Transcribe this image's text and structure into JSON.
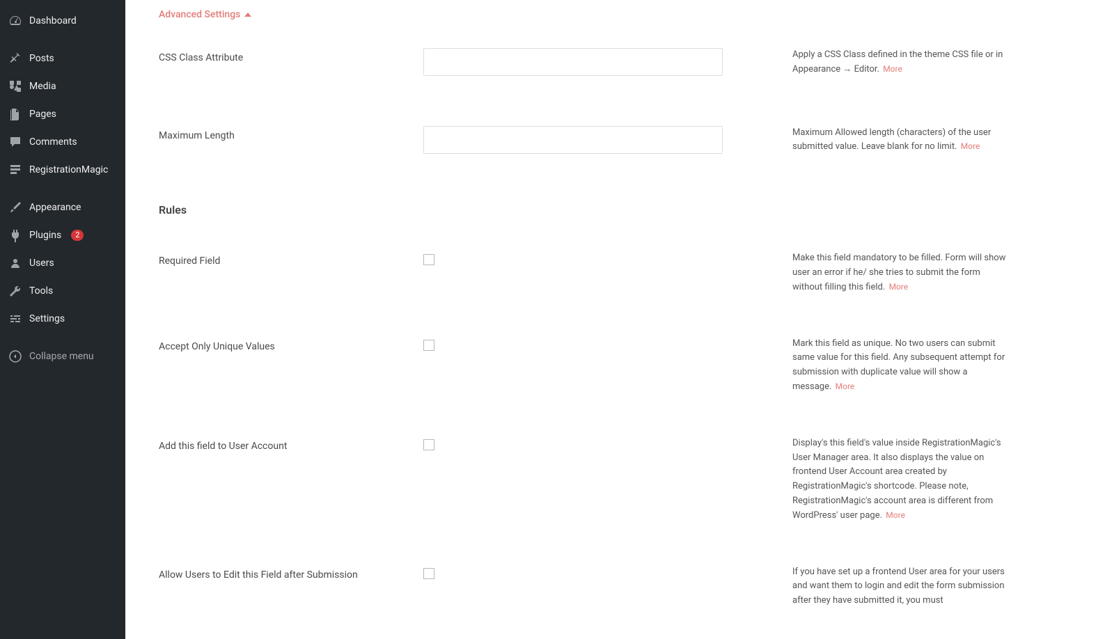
{
  "sidebar": {
    "items": [
      {
        "label": "Dashboard",
        "icon": "dashboard"
      },
      {
        "label": "Posts",
        "icon": "posts"
      },
      {
        "label": "Media",
        "icon": "media"
      },
      {
        "label": "Pages",
        "icon": "pages"
      },
      {
        "label": "Comments",
        "icon": "comments"
      },
      {
        "label": "RegistrationMagic",
        "icon": "regmagic"
      },
      {
        "label": "Appearance",
        "icon": "appearance"
      },
      {
        "label": "Plugins",
        "icon": "plugins",
        "badge": "2"
      },
      {
        "label": "Users",
        "icon": "users"
      },
      {
        "label": "Tools",
        "icon": "tools"
      },
      {
        "label": "Settings",
        "icon": "settings"
      }
    ],
    "collapse_label": "Collapse menu"
  },
  "section_toggle": "Advanced Settings",
  "fields": {
    "css_class": {
      "label": "CSS Class Attribute",
      "help": "Apply a CSS Class defined in the theme CSS file or in Appearance → Editor.",
      "more": "More"
    },
    "max_length": {
      "label": "Maximum Length",
      "help": "Maximum Allowed length (characters) of the user submitted value. Leave blank for no limit.",
      "more": "More"
    },
    "rules_heading": "Rules",
    "required": {
      "label": "Required Field",
      "help": "Make this field mandatory to be filled. Form will show user an error if he/ she tries to submit the form without filling this field.",
      "more": "More"
    },
    "unique": {
      "label": "Accept Only Unique Values",
      "help": "Mark this field as unique. No two users can submit same value for this field. Any subsequent attempt for submission with duplicate value will show a message.",
      "more": "More"
    },
    "user_account": {
      "label": "Add this field to User Account",
      "help": "Display's this field's value inside RegistrationMagic's User Manager area. It also displays the value on frontend User Account area created by RegistrationMagic's shortcode. Please note, RegistrationMagic's account area is different from WordPress' user page.",
      "more": "More"
    },
    "allow_edit": {
      "label": "Allow Users to Edit this Field after Submission",
      "help": "If you have set up a frontend User area for your users and want them to login and edit the form submission after they have submitted it, you must"
    }
  }
}
